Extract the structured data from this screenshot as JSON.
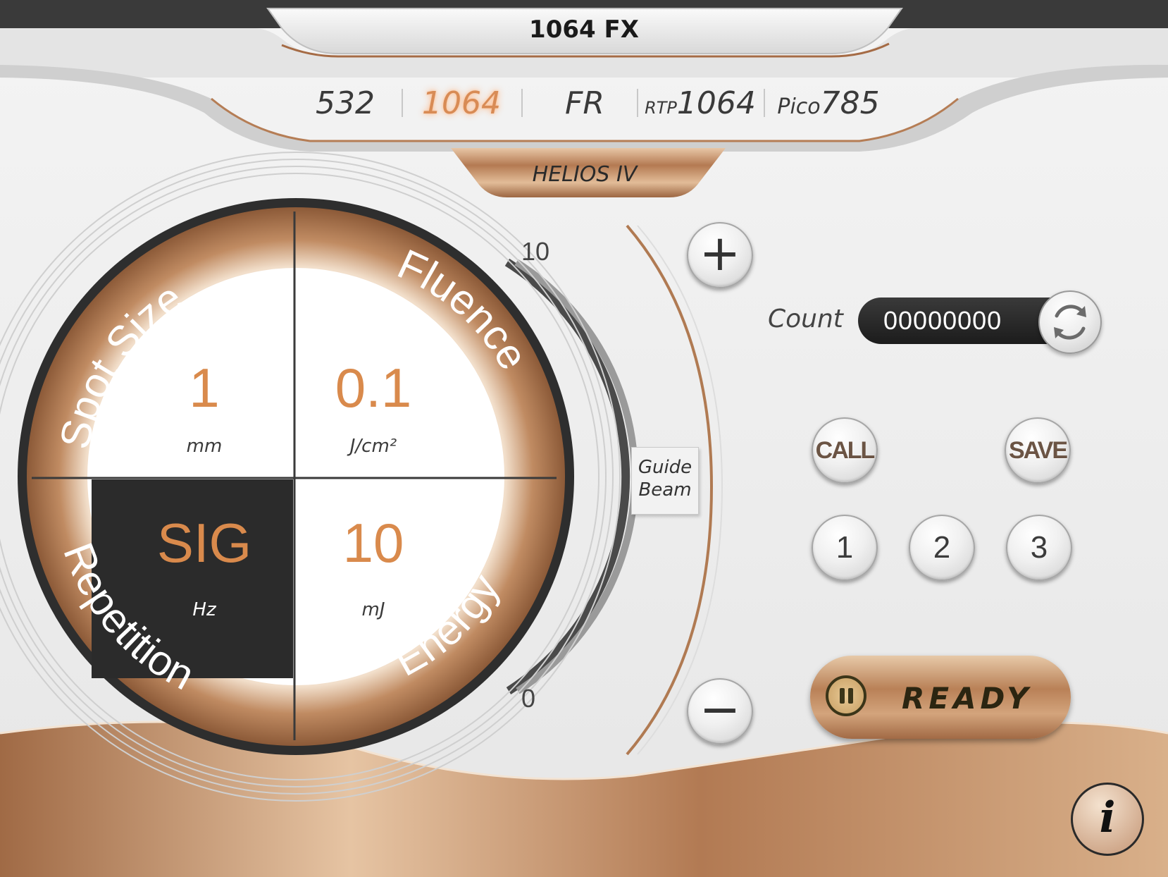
{
  "header": {
    "title": "1064 FX"
  },
  "mode_tabs": [
    {
      "prefix": "",
      "label": "532",
      "active": false
    },
    {
      "prefix": "",
      "label": "1064",
      "active": true
    },
    {
      "prefix": "",
      "label": "FR",
      "active": false
    },
    {
      "prefix": "RTP",
      "label": "1064",
      "active": false
    },
    {
      "prefix": "Pico",
      "label": "785",
      "active": false
    }
  ],
  "device": {
    "name": "HELIOS IV"
  },
  "dial": {
    "spot_size": {
      "title": "Spot Size",
      "value": "1",
      "unit": "mm"
    },
    "fluence": {
      "title": "Fluence",
      "value": "0.1",
      "unit": "J/cm²"
    },
    "repetition": {
      "title": "Repetition",
      "value": "SIG",
      "unit": "Hz"
    },
    "energy": {
      "title": "Energy",
      "value": "10",
      "unit": "mJ"
    }
  },
  "scale": {
    "max_label": "10",
    "min_label": "0",
    "level": 0.0
  },
  "controls": {
    "plus": "+",
    "minus": "−",
    "guide_beam_line1": "Guide",
    "guide_beam_line2": "Beam"
  },
  "counter": {
    "label": "Count",
    "value": "00000000"
  },
  "memory": {
    "call": "CALL",
    "save": "SAVE",
    "slots": [
      "1",
      "2",
      "3"
    ]
  },
  "ready_button": {
    "label": "READY"
  },
  "info_button": {
    "label": "i"
  },
  "colors": {
    "accent": "#d98a4c",
    "bronze": "#b9845e",
    "dark": "#2b2b2b"
  },
  "icons": [
    "reset-counter-icon",
    "pause-icon",
    "info-icon"
  ]
}
